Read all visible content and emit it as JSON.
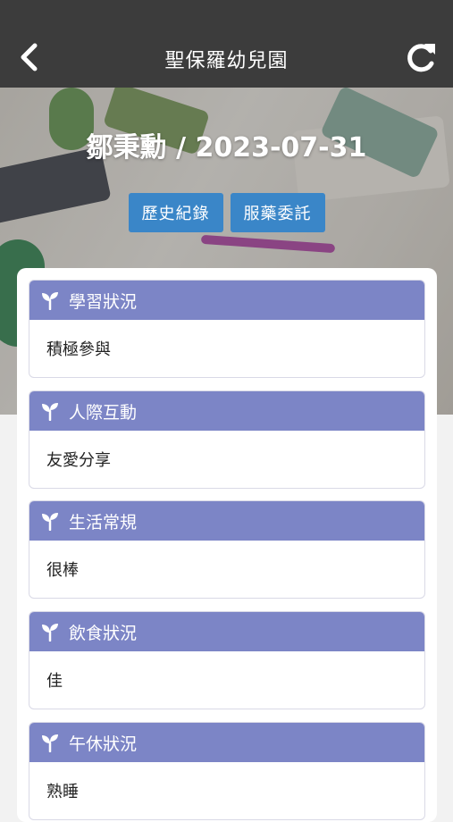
{
  "header": {
    "title": "聖保羅幼兒園",
    "back_icon": "chevron-left-icon",
    "refresh_icon": "refresh-icon"
  },
  "hero": {
    "title": "鄒秉勳 / 2023-07-31",
    "buttons": [
      {
        "label": "歷史紀錄"
      },
      {
        "label": "服藥委託"
      }
    ]
  },
  "sections": [
    {
      "title": "學習狀況",
      "value": "積極參與",
      "icon": "sprout-icon"
    },
    {
      "title": "人際互動",
      "value": "友愛分享",
      "icon": "sprout-icon"
    },
    {
      "title": "生活常規",
      "value": "很棒",
      "icon": "sprout-icon"
    },
    {
      "title": "飲食狀況",
      "value": "佳",
      "icon": "sprout-icon"
    },
    {
      "title": "午休狀況",
      "value": "熟睡",
      "icon": "sprout-icon"
    }
  ],
  "colors": {
    "topbar": "#3c3c3c",
    "section_header": "#7c85c6",
    "button": "#3a86c8"
  }
}
